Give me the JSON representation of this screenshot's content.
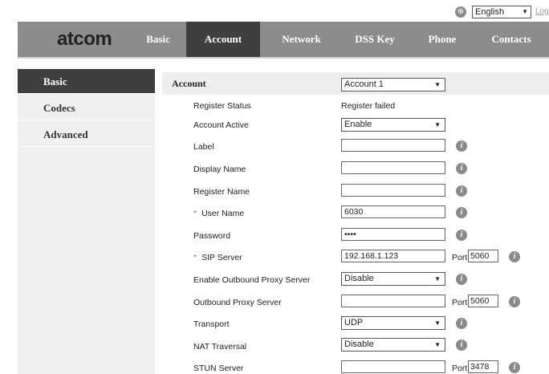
{
  "top": {
    "language": "English",
    "logout": "Log"
  },
  "nav": {
    "logo": "atcom",
    "tabs": [
      "Basic",
      "Account",
      "Network",
      "DSS Key",
      "Phone",
      "Contacts"
    ],
    "active": "Account"
  },
  "sidebar": {
    "items": [
      "Basic",
      "Codecs",
      "Advanced"
    ],
    "active": "Basic"
  },
  "account": {
    "title": "Account",
    "selected_account": "Account 1",
    "fields": {
      "register_status": {
        "label": "Register Status",
        "value": "Register failed"
      },
      "account_active": {
        "label": "Account Active",
        "value": "Enable"
      },
      "label": {
        "label": "Label",
        "value": ""
      },
      "display_name": {
        "label": "Display Name",
        "value": ""
      },
      "register_name": {
        "label": "Register Name",
        "value": ""
      },
      "user_name": {
        "label": "User Name",
        "value": "6030",
        "required_mark": "*"
      },
      "password": {
        "label": "Password",
        "value": "••••"
      },
      "sip_server": {
        "label": "SIP Server",
        "value": "192.168.1.123",
        "required_mark": "*",
        "port_label": "Port",
        "port": "5060"
      },
      "outbound_proxy_enable": {
        "label": "Enable Outbound Proxy Server",
        "value": "Disable"
      },
      "outbound_proxy_server": {
        "label": "Outbound Proxy Server",
        "value": "",
        "port_label": "Port",
        "port": "5060"
      },
      "transport": {
        "label": "Transport",
        "value": "UDP"
      },
      "nat_traversal": {
        "label": "NAT Traversal",
        "value": "Disable"
      },
      "stun_server": {
        "label": "STUN Server",
        "value": "",
        "port_label": "Port",
        "port": "3478"
      }
    }
  },
  "colors": {
    "nav_bg": "#8c8c8c",
    "active_tab_bg": "#3f3f3f",
    "sidebar_bg": "#f0f0f0",
    "info_icon": "#8a8a8a"
  }
}
